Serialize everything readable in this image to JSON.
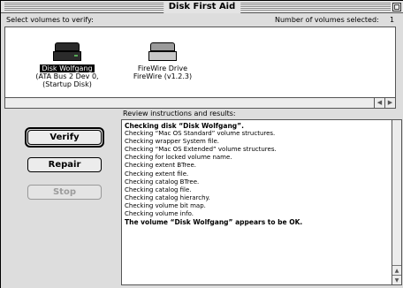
{
  "window": {
    "title": "Disk First Aid"
  },
  "header": {
    "select_label": "Select volumes to verify:",
    "count_label": "Number of volumes selected:",
    "count_value": "1"
  },
  "volumes": [
    {
      "name": "Disk Wolfgang",
      "detail_1": "(ATA Bus 2 Dev 0,",
      "detail_2": "(Startup Disk)",
      "selected": true,
      "icon": "hard-disk-icon"
    },
    {
      "name": "FireWire Drive",
      "detail_1": "FireWire (v1.2.3)",
      "selected": false,
      "icon": "firewire-drive-icon"
    }
  ],
  "buttons": {
    "verify": "Verify",
    "repair": "Repair",
    "stop": "Stop"
  },
  "results": {
    "label": "Review instructions and results:",
    "lines": [
      {
        "text": "Checking disk “Disk Wolfgang”.",
        "bold": true
      },
      {
        "text": "Checking “Mac OS Standard” volume structures.",
        "bold": false
      },
      {
        "text": "Checking wrapper System file.",
        "bold": false
      },
      {
        "text": "Checking “Mac OS Extended” volume structures.",
        "bold": false
      },
      {
        "text": "Checking for locked volume name.",
        "bold": false
      },
      {
        "text": "Checking extent BTree.",
        "bold": false
      },
      {
        "text": "Checking extent file.",
        "bold": false
      },
      {
        "text": "Checking catalog BTree.",
        "bold": false
      },
      {
        "text": "Checking catalog file.",
        "bold": false
      },
      {
        "text": "Checking catalog hierarchy.",
        "bold": false
      },
      {
        "text": "Checking volume bit map.",
        "bold": false
      },
      {
        "text": "Checking volume info.",
        "bold": false
      },
      {
        "text": "The volume “Disk Wolfgang” appears to be OK.",
        "bold": true
      }
    ]
  },
  "colors": {
    "window_bg": "#dddddd",
    "selection": "#000000",
    "disabled_text": "#9c9c9c"
  }
}
